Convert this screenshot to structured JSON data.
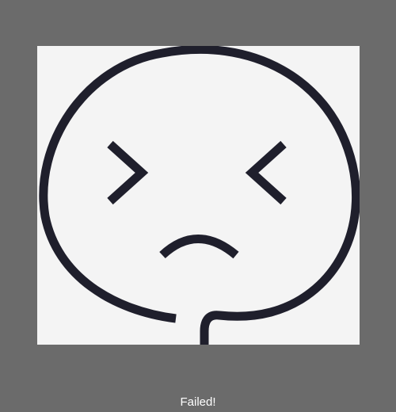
{
  "status": {
    "message": "Failed!"
  },
  "illustration": {
    "icon": "sad-face-icon",
    "stroke_color": "#1f1f2c",
    "background_color": "#f4f4f4"
  },
  "colors": {
    "backdrop": "#6b6b6b",
    "text": "#ffffff"
  }
}
